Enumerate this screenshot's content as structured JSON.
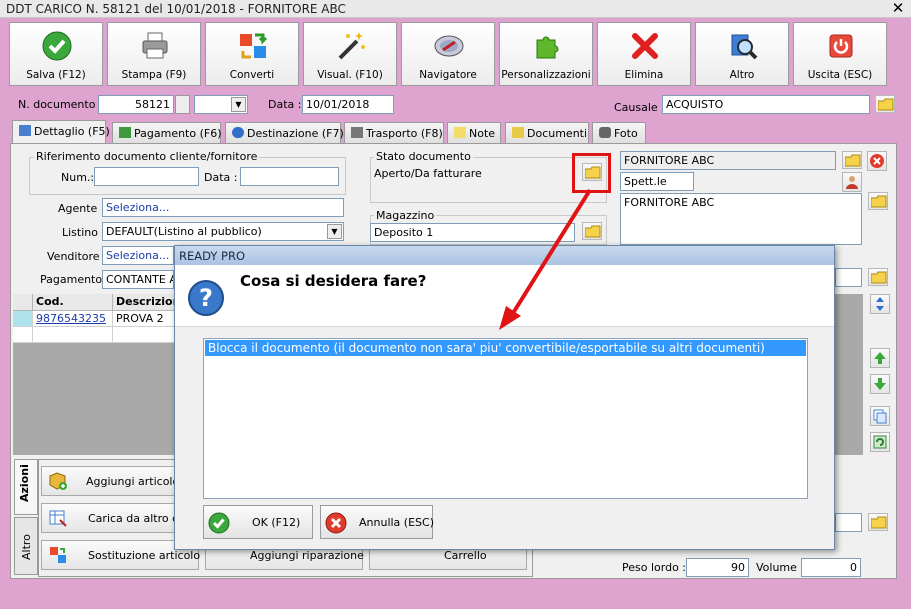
{
  "window": {
    "title": "DDT CARICO N. 58121 del 10/01/2018 - FORNITORE ABC",
    "close": "✕"
  },
  "toolbar": [
    {
      "label": "Salva (F12)",
      "icon": "check-icon"
    },
    {
      "label": "Stampa (F9)",
      "icon": "printer-icon"
    },
    {
      "label": "Converti",
      "icon": "convert-icon"
    },
    {
      "label": "Visual. (F10)",
      "icon": "magic-wand-icon"
    },
    {
      "label": "Navigatore",
      "icon": "compass-icon"
    },
    {
      "label": "Personalizzazioni",
      "icon": "puzzle-icon"
    },
    {
      "label": "Elimina",
      "icon": "delete-x-icon"
    },
    {
      "label": "Altro",
      "icon": "magnifier-icon"
    },
    {
      "label": "Uscita (ESC)",
      "icon": "power-icon"
    }
  ],
  "header": {
    "doc_number_label": "N. documento :",
    "doc_number": "58121",
    "date_label": "Data :",
    "date": "10/01/2018",
    "causale_label": "Causale :",
    "causale": "ACQUISTO"
  },
  "tabs": [
    {
      "label": "Dettaglio (F5)"
    },
    {
      "label": "Pagamento (F6)"
    },
    {
      "label": "Destinazione (F7)"
    },
    {
      "label": "Trasporto (F8)"
    },
    {
      "label": "Note"
    },
    {
      "label": "Documenti"
    },
    {
      "label": "Foto"
    }
  ],
  "riferimento": {
    "title": "Riferimento documento cliente/fornitore",
    "num_label": "Num.:",
    "num": "",
    "data_label": "Data :",
    "data": ""
  },
  "stato": {
    "title": "Stato documento",
    "value": "Aperto/Da fatturare"
  },
  "magazzino": {
    "title": "Magazzino",
    "value": "Deposito 1"
  },
  "form": {
    "agente_label": "Agente :",
    "agente": "Seleziona...",
    "listino_label": "Listino :",
    "listino": "DEFAULT(Listino al pubblico)",
    "venditore_label": "Venditore :",
    "venditore": "Seleziona...",
    "pagamento_label": "Pagamento :",
    "pagamento": "CONTANTE AL"
  },
  "supplier": {
    "name": "FORNITORE ABC",
    "salutation": "Spett.le",
    "address": "FORNITORE ABC"
  },
  "grid": {
    "columns": [
      "Cod.",
      "Descrizion"
    ],
    "rows": [
      [
        "9876543235",
        "PROVA 2"
      ]
    ]
  },
  "actions": {
    "side_tabs": [
      "Azioni",
      "Altro"
    ],
    "buttons": [
      "Aggiungi articolo (F",
      "Carica da altro do",
      "Sostituzione articolo",
      "Aggiungi riparazione",
      "Carrello"
    ]
  },
  "footer": {
    "peso_label": "Peso lordo :",
    "peso": "90",
    "volume_label": "Volume :",
    "volume": "0"
  },
  "dialog": {
    "title": "READY PRO",
    "question": "Cosa si desidera fare?",
    "options": [
      "Blocca il documento (il documento non sara' piu' convertibile/esportabile su altri documenti)"
    ],
    "ok": "OK (F12)",
    "cancel": "Annulla (ESC)"
  },
  "colors": {
    "background": "#dfa3cf",
    "selection": "#3399ff",
    "annotation": "#e01414"
  }
}
